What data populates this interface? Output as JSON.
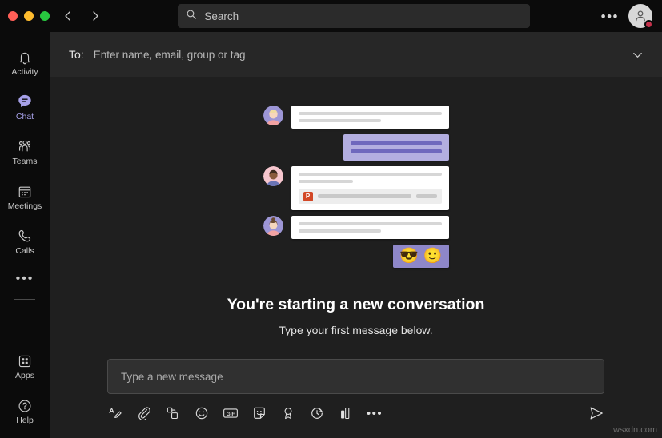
{
  "window": {
    "traffic_lights": [
      "close",
      "minimize",
      "maximize"
    ],
    "nav": {
      "back": "back-arrow",
      "forward": "forward-arrow"
    }
  },
  "search": {
    "placeholder": "Search",
    "icon": "search-icon"
  },
  "topbar": {
    "more_label": "•••",
    "avatar_icon": "person-icon",
    "presence": "busy",
    "presence_color": "#c4314b"
  },
  "rail": {
    "items": [
      {
        "label": "Activity",
        "icon": "bell-icon",
        "active": false
      },
      {
        "label": "Chat",
        "icon": "chat-bubble-icon",
        "active": true
      },
      {
        "label": "Teams",
        "icon": "people-icon",
        "active": false
      },
      {
        "label": "Meetings",
        "icon": "calendar-icon",
        "active": false
      },
      {
        "label": "Calls",
        "icon": "phone-icon",
        "active": false
      }
    ],
    "more_label": "•••",
    "bottom_items": [
      {
        "label": "Apps",
        "icon": "grid-apps-icon"
      },
      {
        "label": "Help",
        "icon": "question-circle-icon"
      }
    ],
    "active_color": "#a6a0e8"
  },
  "to_header": {
    "label": "To:",
    "placeholder": "Enter name, email, group or tag",
    "expand_icon": "chevron-down-icon"
  },
  "illustration": {
    "messages": [
      {
        "sender": "other",
        "avatar": "avatar-blonde-woman",
        "lines": [
          "100",
          "60"
        ]
      },
      {
        "sender": "me",
        "lines": [
          "100",
          "100"
        ]
      },
      {
        "sender": "other",
        "avatar": "avatar-dark-skin-person",
        "lines": [
          "100",
          "40"
        ],
        "attachment": {
          "type": "powerpoint",
          "glyph": "P"
        }
      },
      {
        "sender": "other",
        "avatar": "avatar-bun-woman",
        "lines": [
          "100",
          "60"
        ]
      },
      {
        "sender": "me",
        "emoji": [
          "😎",
          "🙂"
        ]
      }
    ],
    "bubble_white": "#ffffff",
    "bubble_purple": "#b3aee0",
    "emoji_bubble": "#8e87c9"
  },
  "empty_state": {
    "title": "You're starting a new conversation",
    "subtitle": "Type your first message below."
  },
  "compose": {
    "placeholder": "Type a new message",
    "toolbar": [
      {
        "name": "format-text-icon",
        "label": "Format"
      },
      {
        "name": "attach-paperclip-icon",
        "label": "Attach"
      },
      {
        "name": "loop-components-icon",
        "label": "Loop components"
      },
      {
        "name": "emoji-icon",
        "label": "Emoji"
      },
      {
        "name": "gif-icon",
        "label": "GIF"
      },
      {
        "name": "sticker-icon",
        "label": "Sticker"
      },
      {
        "name": "praise-badge-icon",
        "label": "Praise"
      },
      {
        "name": "meet-now-icon",
        "label": "Meet now"
      },
      {
        "name": "poll-icon",
        "label": "Poll"
      },
      {
        "name": "more-options-icon",
        "label": "•••"
      }
    ],
    "send_icon": "send-paper-plane-icon"
  },
  "watermark": "wsxdn.com"
}
